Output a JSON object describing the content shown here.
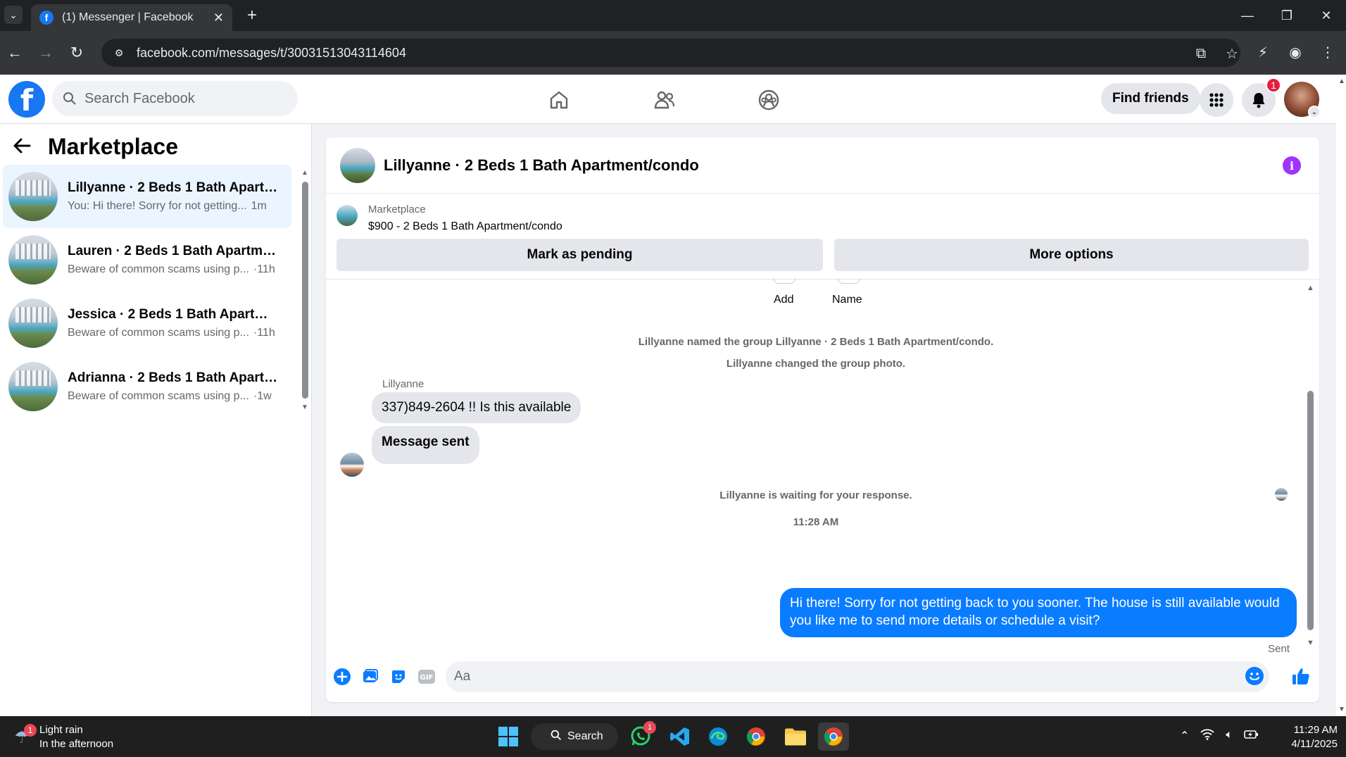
{
  "browser": {
    "tab_title": "(1) Messenger | Facebook",
    "url": "facebook.com/messages/t/30031513043114604"
  },
  "fb_header": {
    "search_placeholder": "Search Facebook",
    "find_friends_label": "Find friends",
    "notification_count": "1"
  },
  "left_panel": {
    "title": "Marketplace",
    "conversations": [
      {
        "name": "Lillyanne · 2 Beds 1 Bath Apartm...",
        "preview": "You: Hi there! Sorry for not getting...",
        "time": "1m",
        "active": true
      },
      {
        "name": "Lauren · 2 Beds 1 Bath Apartmen...",
        "preview": "Beware of common scams using p...",
        "time": "·11h",
        "active": false
      },
      {
        "name": "Jessica · 2 Beds 1 Bath Apartmen...",
        "preview": "Beware of common scams using p...",
        "time": "·11h",
        "active": false
      },
      {
        "name": "Adrianna · 2 Beds 1 Bath Apartm...",
        "preview": "Beware of common scams using p...",
        "time": "·1w",
        "active": false
      }
    ]
  },
  "chat": {
    "title": "Lillyanne · 2 Beds 1 Bath Apartment/condo",
    "listing": {
      "source": "Marketplace",
      "title": "$900 - 2 Beds 1 Bath Apartment/condo",
      "mark_pending_label": "Mark as pending",
      "more_options_label": "More options"
    },
    "group_actions": {
      "add_label": "Add",
      "name_label": "Name"
    },
    "system_messages": {
      "named_group": "Lillyanne named the group Lillyanne · 2 Beds 1 Bath Apartment/condo.",
      "changed_photo": "Lillyanne changed the group photo.",
      "waiting": "Lillyanne is waiting for your response."
    },
    "sender_name": "Lillyanne",
    "incoming_messages": [
      "337)849-2604 !! Is this available",
      "Message sent"
    ],
    "timestamp": "11:28 AM",
    "outgoing_message": "Hi there! Sorry for not getting back to you sooner. The house is still available would you like me to send more details or schedule a visit?",
    "sent_status": "Sent",
    "composer_placeholder": "Aa"
  },
  "taskbar": {
    "weather_title": "Light rain",
    "weather_subtitle": "In the afternoon",
    "weather_badge": "1",
    "search_label": "Search",
    "whatsapp_badge": "1",
    "time": "11:29 AM",
    "date": "4/11/2025"
  },
  "colors": {
    "fb_blue": "#1877f2",
    "messenger_blue": "#0a7cff",
    "info_purple": "#a033ff",
    "active_conv_bg": "#ebf5ff"
  }
}
